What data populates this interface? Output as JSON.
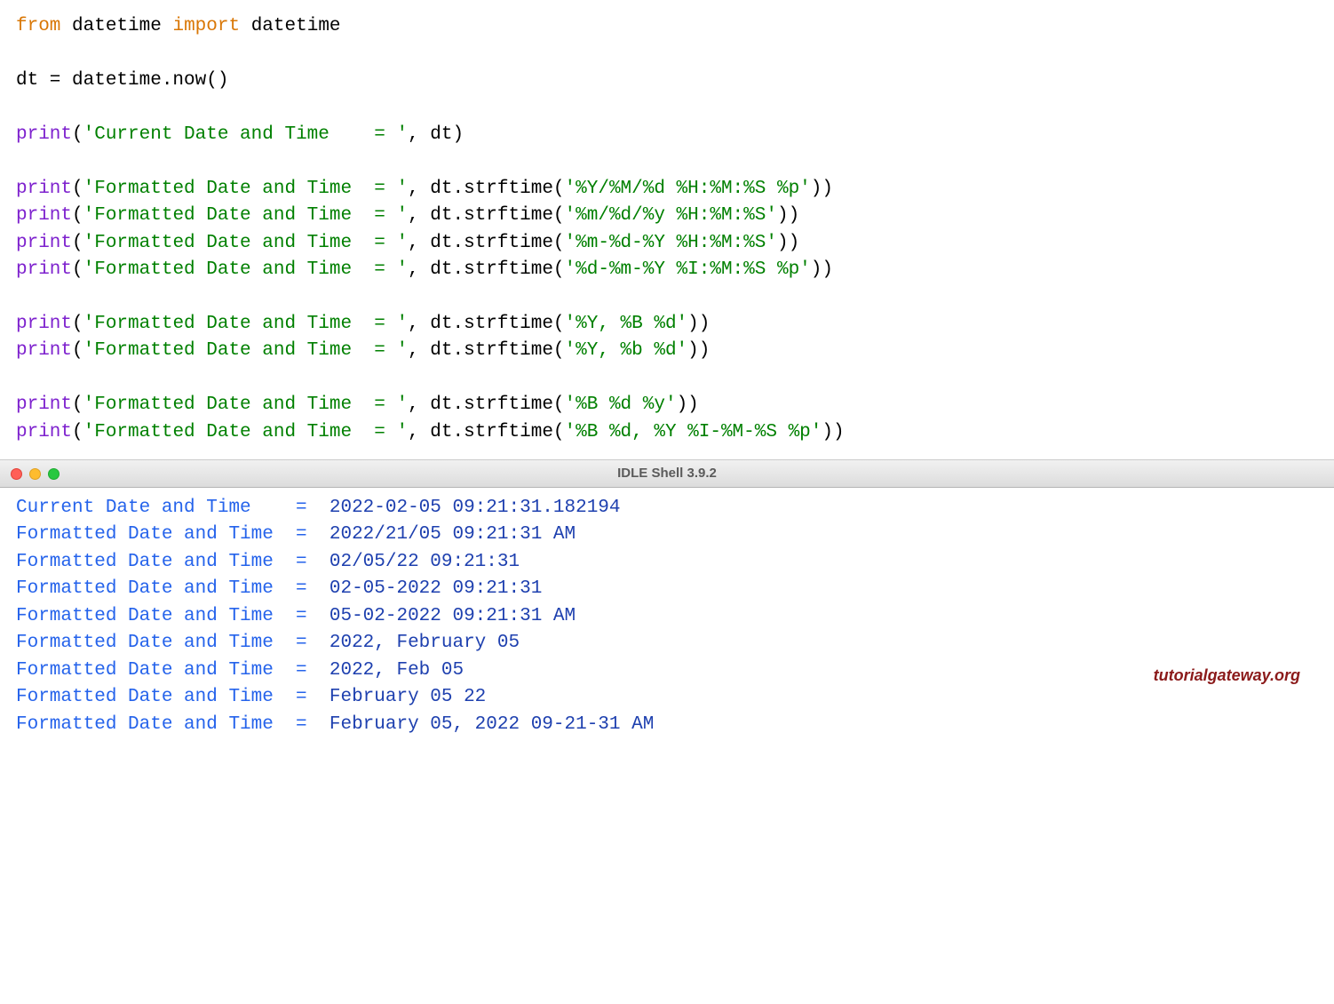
{
  "code": {
    "kw_from": "from",
    "kw_import": "import",
    "id_datetime1": "datetime",
    "id_datetime2": "datetime",
    "assign_line_pre": "dt = datetime.now()",
    "print_fn": "print",
    "str_current": "'Current Date and Time    = '",
    "arg_dt": ", dt)",
    "str_formatted": "'Formatted Date and Time  = '",
    "call_prefix": ", dt.strftime(",
    "fmt1": "'%Y/%M/%d %H:%M:%S %p'",
    "fmt2": "'%m/%d/%y %H:%M:%S'",
    "fmt3": "'%m-%d-%Y %H:%M:%S'",
    "fmt4": "'%d-%m-%Y %I:%M:%S %p'",
    "fmt5": "'%Y, %B %d'",
    "fmt6": "'%Y, %b %d'",
    "fmt7": "'%B %d %y'",
    "fmt8": "'%B %d, %Y %I-%M-%S %p'",
    "close_paren": "))"
  },
  "shell": {
    "title": "IDLE Shell 3.9.2",
    "lines": [
      {
        "label": "Current Date and Time    =  ",
        "value": "2022-02-05 09:21:31.182194"
      },
      {
        "label": "Formatted Date and Time  =  ",
        "value": "2022/21/05 09:21:31 AM"
      },
      {
        "label": "Formatted Date and Time  =  ",
        "value": "02/05/22 09:21:31"
      },
      {
        "label": "Formatted Date and Time  =  ",
        "value": "02-05-2022 09:21:31"
      },
      {
        "label": "Formatted Date and Time  =  ",
        "value": "05-02-2022 09:21:31 AM"
      },
      {
        "label": "Formatted Date and Time  =  ",
        "value": "2022, February 05"
      },
      {
        "label": "Formatted Date and Time  =  ",
        "value": "2022, Feb 05"
      },
      {
        "label": "Formatted Date and Time  =  ",
        "value": "February 05 22"
      },
      {
        "label": "Formatted Date and Time  =  ",
        "value": "February 05, 2022 09-21-31 AM"
      }
    ]
  },
  "watermark": "tutorialgateway.org"
}
